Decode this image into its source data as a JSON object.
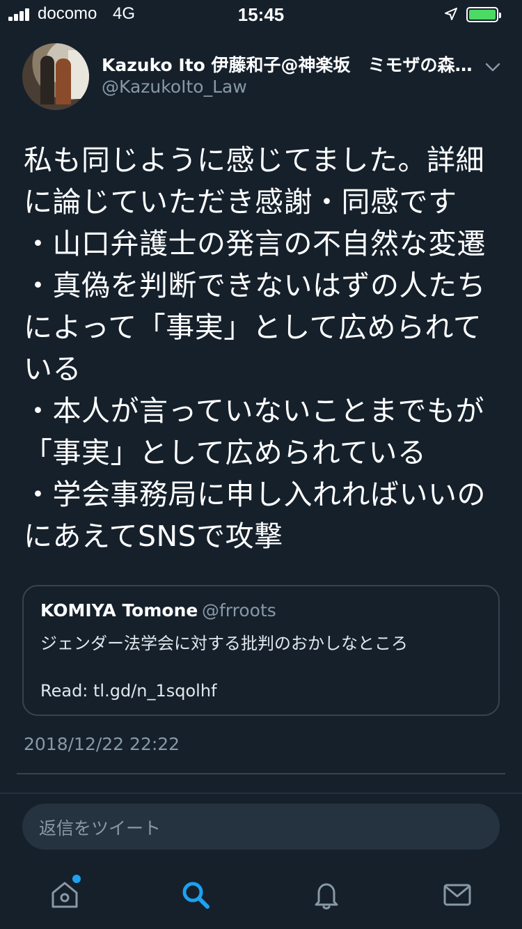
{
  "status_bar": {
    "carrier": "docomo",
    "network": "4G",
    "time": "15:45",
    "battery_color": "#4cd964",
    "icons": [
      "signal-icon",
      "location-icon",
      "battery-icon"
    ]
  },
  "tweet": {
    "author_name": "Kazuko Ito 伊藤和子@神楽坂　ミモザの森法律事務所",
    "author_handle": "@KazukoIto_Law",
    "text": "私も同じように感じてました。詳細\nに論じていただき感謝・同感です\n・山口弁護士の発言の不自然な変遷\n・真偽を判断できないはずの人たち\nによって「事実」として広められて\nいる\n・本人が言っていないことまでもが\n「事実」として広められている\n・学会事務局に申し入れればいいの\nにあえてSNSで攻撃",
    "timestamp": "2018/12/22 22:22"
  },
  "quoted_tweet": {
    "name": "KOMIYA Tomone",
    "handle": "@frroots",
    "text": "ジェンダー法学会に対する批判のおかしなところ",
    "link": "Read: tl.gd/n_1sqolhf"
  },
  "reply_bar": {
    "placeholder": "返信をツイート"
  },
  "tab_bar": {
    "items": [
      "home-icon",
      "search-icon",
      "notifications-icon",
      "messages-icon"
    ],
    "active": "search-icon",
    "active_color": "#1da1f2"
  },
  "colors": {
    "background": "#15202b",
    "secondary_text": "#8899a6",
    "border": "#38444d"
  }
}
